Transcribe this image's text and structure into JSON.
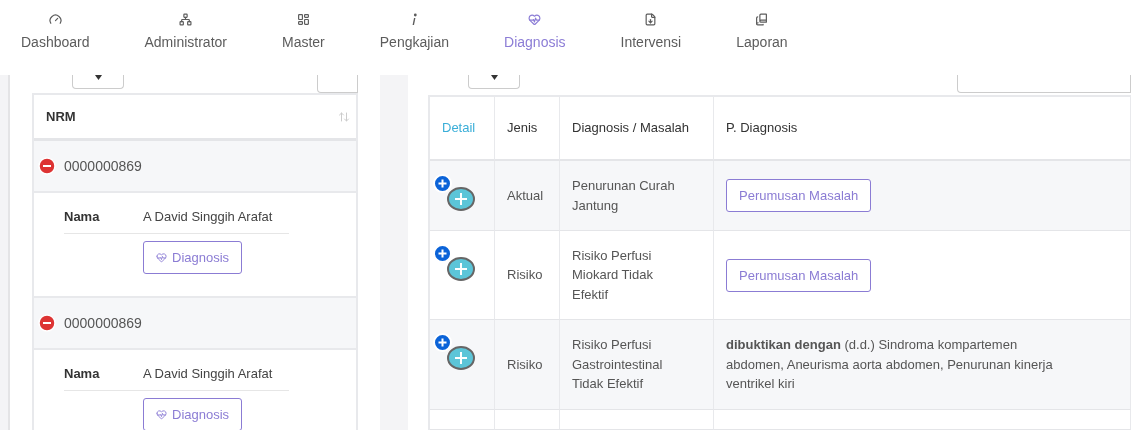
{
  "nav": {
    "items": [
      {
        "kind": "gauge",
        "label": "Dashboard",
        "selected": false
      },
      {
        "kind": "network",
        "label": "Administrator",
        "selected": false
      },
      {
        "kind": "grid",
        "label": "Master",
        "selected": false
      },
      {
        "kind": "info",
        "label": "Pengkajian",
        "selected": false
      },
      {
        "kind": "heart",
        "label": "Diagnosis",
        "selected": true
      },
      {
        "kind": "file",
        "label": "Intervensi",
        "selected": false
      },
      {
        "kind": "book",
        "label": "Laporan",
        "selected": false
      }
    ]
  },
  "patients": {
    "column": "NRM",
    "rows": [
      {
        "nrm": "0000000869",
        "expanded": true,
        "name_label": "Nama",
        "name": "A David Singgih Arafat",
        "button": "Diagnosis"
      },
      {
        "nrm": "0000000869",
        "expanded": true,
        "name_label": "Nama",
        "name": "A David Singgih Arafat",
        "button": "Diagnosis"
      }
    ]
  },
  "diagnoses": {
    "columns": [
      {
        "label": "Detail",
        "kind": "link"
      },
      {
        "label": "Jenis",
        "kind": "plain"
      },
      {
        "label": "Diagnosis / Masalah",
        "kind": "plain"
      },
      {
        "label": "P. Diagnosis",
        "kind": "plain"
      }
    ],
    "rows": [
      {
        "expanded": false,
        "jenis": "Aktual",
        "diagnosis": "Penurunan Curah Jantung",
        "p_diagnosis": {
          "kind": "button",
          "text": "Perumusan Masalah"
        }
      },
      {
        "expanded": false,
        "jenis": "Risiko",
        "diagnosis": "Risiko Perfusi Miokard Tidak Efektif",
        "p_diagnosis": {
          "kind": "button",
          "text": "Perumusan Masalah"
        }
      },
      {
        "expanded": false,
        "jenis": "Risiko",
        "diagnosis": "Risiko Perfusi Gastrointestinal Tidak Efektif",
        "p_diagnosis": {
          "kind": "text",
          "text": "**dibuktikan dengan** (d.d.) Sindroma kompartemen abdomen, Aneurisma aorta abdomen, Penurunan kinerja ventrikel kiri"
        }
      }
    ]
  }
}
